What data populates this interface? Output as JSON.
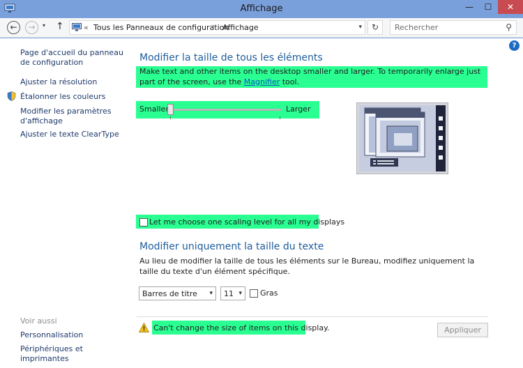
{
  "window": {
    "title": "Affichage",
    "minimize_glyph": "—",
    "maximize_glyph": "☐",
    "close_glyph": "✕"
  },
  "addressbar": {
    "back_glyph": "←",
    "forward_glyph": "→",
    "recent_glyph": "▾",
    "up_glyph": "↑",
    "separator": "«",
    "crumbs": [
      "Tous les Panneaux de configuration",
      "Affichage"
    ],
    "crumb_arrow": "›",
    "dropdown_glyph": "▾",
    "refresh_glyph": "↻",
    "search_placeholder": "Rechercher",
    "search_glyph": "⚲"
  },
  "help": {
    "glyph": "?"
  },
  "sidebar": {
    "items": [
      "Page d'accueil du panneau de configuration",
      "Ajuster la résolution",
      "Étalonner les couleurs",
      "Modifier les paramètres d'affichage",
      "Ajuster le texte ClearType"
    ],
    "see_also_heading": "Voir aussi",
    "see_also": [
      "Personnalisation",
      "Périphériques et imprimantes"
    ]
  },
  "main": {
    "heading": "Modifier la taille de tous les éléments",
    "description_before": "Make text and other items on the desktop smaller and larger. To temporarily enlarge just part of the screen, use the ",
    "magnifier_link": "Magnifier",
    "description_after": " tool.",
    "slider": {
      "min_label": "Smaller",
      "max_label": "Larger",
      "value_fraction": 0.0
    },
    "scaling_checkbox_label": "Let me choose one scaling level for all my displays",
    "scaling_checkbox_checked": false,
    "text_heading": "Modifier uniquement la taille du texte",
    "text_description": "Au lieu de modifier la taille de tous les éléments sur le Bureau, modifiez uniquement la taille du texte d'un élément spécifique.",
    "element_select": "Barres de titre",
    "size_select": "11",
    "bold_label": "Gras",
    "bold_checked": false,
    "warning": "Can't change the size of items on this display.",
    "apply_label": "Appliquer",
    "select_arrow": "▾"
  },
  "colors": {
    "accent": "#1d5c9b",
    "link": "#0b5bbf",
    "highlight": "#2aff92",
    "title_bar": "#7aa0dc",
    "close_button": "#c74b50"
  }
}
